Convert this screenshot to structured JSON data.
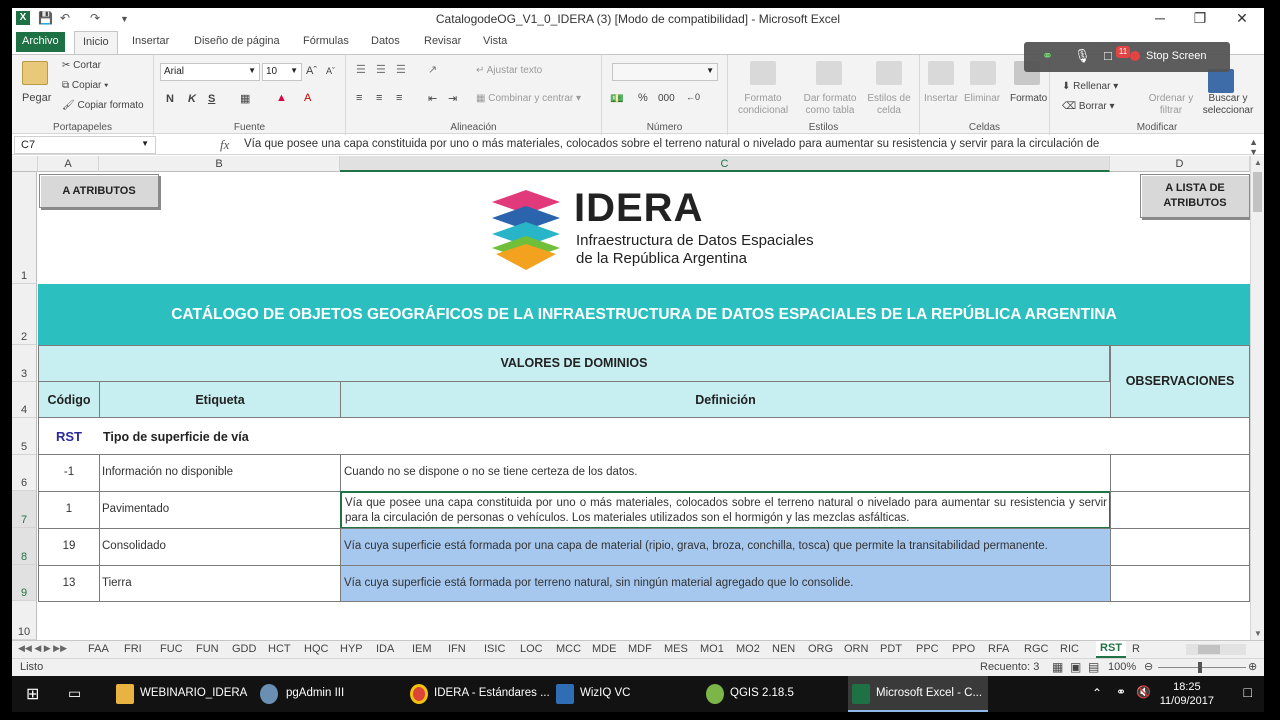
{
  "window": {
    "title": "CatalogodeOG_V1_0_IDERA (3)  [Modo de compatibilidad] - Microsoft Excel",
    "app_icon": "X",
    "controls": [
      "─",
      "❐",
      "✕"
    ]
  },
  "ribbon_tabs": [
    "Archivo",
    "Inicio",
    "Insertar",
    "Diseño de página",
    "Fórmulas",
    "Datos",
    "Revisar",
    "Vista"
  ],
  "ribbon": {
    "portapapeles": {
      "paste": "Pegar",
      "cut": "Cortar",
      "copy": "Copiar",
      "format_copy": "Copiar formato",
      "label": "Portapapeles"
    },
    "fuente": {
      "font": "Arial",
      "size": "10",
      "bold": "N",
      "italic": "K",
      "underline": "S",
      "label": "Fuente"
    },
    "alineacion": {
      "wrap": "Ajustar texto",
      "merge": "Combinar y centrar",
      "label": "Alineación"
    },
    "numero": {
      "percent": "%",
      "thousands": "000",
      "label": "Número"
    },
    "estilos": {
      "cond": "Formato condicional",
      "table": "Dar formato como tabla",
      "cell": "Estilos de celda",
      "label": "Estilos"
    },
    "celdas": {
      "insert": "Insertar",
      "delete": "Eliminar",
      "format": "Formato",
      "label": "Celdas"
    },
    "modificar": {
      "fill": "Rellenar",
      "clear": "Borrar",
      "sort": "Ordenar y filtrar",
      "find": "Buscar y seleccionar",
      "label": "Modificar"
    }
  },
  "overlay": {
    "stop_label": "Stop Screen",
    "badge": "11"
  },
  "formula_bar": {
    "name_box": "C7",
    "fx": "fx",
    "content": "Vía que posee una capa constituida por uno o más materiales, colocados sobre el terreno natural o nivelado para aumentar su resistencia y servir para la circulación de"
  },
  "columns": [
    "A",
    "B",
    "C",
    "D"
  ],
  "rows": [
    "1",
    "2",
    "3",
    "4",
    "5",
    "6",
    "7",
    "8",
    "9",
    "10"
  ],
  "sheet": {
    "btn_atributos": "A  ATRIBUTOS",
    "btn_lista": "A  LISTA DE ATRIBUTOS",
    "logo_title": "IDERA",
    "logo_sub1": "Infraestructura de Datos Espaciales",
    "logo_sub2": "de la República Argentina",
    "catalog_title": "CATÁLOGO DE OBJETOS GEOGRÁFICOS DE LA INFRAESTRUCTURA DE DATOS ESPACIALES DE LA REPÚBLICA ARGENTINA",
    "valores": "VALORES DE DOMINIOS",
    "observaciones": "OBSERVACIONES",
    "h_codigo": "Código",
    "h_etiqueta": "Etiqueta",
    "h_definicion": "Definición",
    "attr_code": "RST",
    "attr_name": "Tipo de superficie de vía",
    "values": [
      {
        "code": "-1",
        "label": "Información no disponible",
        "definition": "Cuando no se dispone o no se tiene certeza de los datos."
      },
      {
        "code": "1",
        "label": "Pavimentado",
        "definition": "Vía que posee una capa constituida por uno o más materiales, colocados sobre el terreno natural o nivelado para aumentar su resistencia y servir para la circulación de personas o vehículos. Los materiales utilizados son el hormigón y las mezclas asfálticas."
      },
      {
        "code": "19",
        "label": "Consolidado",
        "definition": "Vía cuya superficie está formada por una capa de material (ripio, grava, broza, conchilla, tosca) que permite la transitabilidad permanente."
      },
      {
        "code": "13",
        "label": "Tierra",
        "definition": "Vía cuya superficie está formada por terreno natural, sin ningún material agregado que lo consolide."
      }
    ]
  },
  "sheet_tabs": [
    "FAA",
    "FRI",
    "FUC",
    "FUN",
    "GDD",
    "HCT",
    "HQC",
    "HYP",
    "IDA",
    "IEM",
    "IFN",
    "ISIC",
    "LOC",
    "MCC",
    "MDE",
    "MDF",
    "MES",
    "MO1",
    "MO2",
    "NEN",
    "ORG",
    "ORN",
    "PDT",
    "PPC",
    "PPO",
    "RFA",
    "RGC",
    "RIC",
    "RST",
    "R"
  ],
  "active_sheet": "RST",
  "status": {
    "ready": "Listo",
    "count": "Recuento: 3",
    "zoom": "100%"
  },
  "taskbar": {
    "items": [
      "WEBINARIO_IDERA",
      "pgAdmin III",
      "IDERA - Estándares ...",
      "WizIQ VC",
      "QGIS 2.18.5",
      "Microsoft Excel - C..."
    ],
    "time": "18:25",
    "date": "11/09/2017"
  },
  "colors": {
    "teal": "#2bbfc0",
    "light_teal": "#c7eef0",
    "excel_green": "#1e7145",
    "selection": "#a6c8ef"
  }
}
